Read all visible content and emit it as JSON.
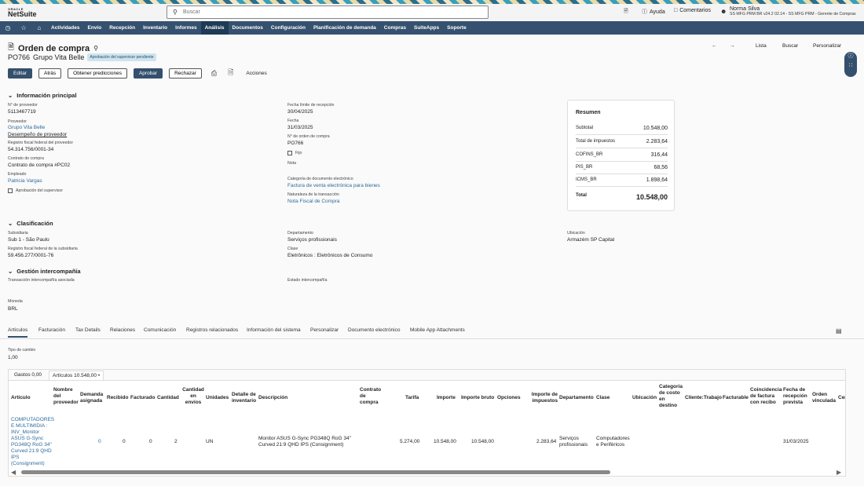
{
  "header": {
    "logo_oracle": "ORACLE",
    "logo_netsuite": "NetSuite",
    "search_placeholder": "Buscar",
    "help": "Ayuda",
    "comments": "Comentarios",
    "user_name": "Norma Silva",
    "user_role": "SS MFG PRM BR v24.2 02.14 - SS MFG PRM -  Gerente de Compras"
  },
  "nav": {
    "items": [
      "Actividades",
      "Envío",
      "Recepción",
      "Inventario",
      "Informes",
      "Análisis",
      "Documentos",
      "Configuración",
      "Planificación de demanda",
      "Compras",
      "SuiteApps",
      "Soporte"
    ],
    "active": "Análisis"
  },
  "page": {
    "title": "Orden de compra",
    "record_id": "PO766",
    "vendor_name": "Grupo Vita Belle",
    "status_badge": "Aprobación del supervisor pendiente",
    "right_links": {
      "list": "Lista",
      "search": "Buscar",
      "customize": "Personalizar"
    },
    "buttons": {
      "edit": "Editar",
      "back": "Atrás",
      "predictions": "Obtener predicciones",
      "approve": "Aprobar",
      "reject": "Rechazar",
      "actions": "Acciones"
    }
  },
  "main_info": {
    "section_title": "Información principal",
    "vendor_no_label": "N° de proveedor",
    "vendor_no": "5113467719",
    "vendor_label": "Proveedor",
    "vendor": "Grupo Vita Belle",
    "vendor_performance": "Desempeño de proveedor",
    "tax_id_label": "Registro fiscal federal del proveedor",
    "tax_id": "54.314.756/0001-34",
    "contract_label": "Contrato de compra",
    "contract": "Contrato de compra #PC02",
    "employee_label": "Empleado",
    "employee": "Patricia Vargas",
    "supervisor_approval": "Aprobación del supervisor",
    "receipt_deadline_label": "Fecha límite de recepción",
    "receipt_deadline": "30/04/2025",
    "date_label": "Fecha",
    "date": "31/03/2025",
    "po_no_label": "N° de orden de compra",
    "po_no": "PO766",
    "fixed_label": "Fijo",
    "note_label": "Nota",
    "edoc_category_label": "Categoría de documento electrónico",
    "edoc_category": "Factura de venta electrónica para bienes",
    "transaction_nature_label": "Naturaleza de la transacción",
    "transaction_nature": "Nota Fiscal de Compra"
  },
  "summary": {
    "title": "Resumen",
    "rows": [
      {
        "label": "Subtotal",
        "value": "10.548,00"
      },
      {
        "label": "Total de impuestos",
        "value": "2.283,64"
      },
      {
        "label": "COFINS_BR",
        "value": "316,44"
      },
      {
        "label": "PIS_BR",
        "value": "68,56"
      },
      {
        "label": "ICMS_BR",
        "value": "1.898,64"
      }
    ],
    "total_label": "Total",
    "total_value": "10.548,00"
  },
  "classification": {
    "section_title": "Clasificación",
    "subsidiary_label": "Subsidiaria",
    "subsidiary": "Sub 1 - São Paulo",
    "sub_tax_label": "Registro fiscal federal de la subsidiaria",
    "sub_tax": "59.456.277/0001-76",
    "department_label": "Departamento",
    "department": "Serviços profissionais",
    "class_label": "Clase",
    "class": "Eletrônicos : Eletrônicos de Consumo",
    "location_label": "Ubicación",
    "location": "Armazém SP Capital"
  },
  "intercompany": {
    "section_title": "Gestión intercompañía",
    "assoc_label": "Transacción intercompañía asociada",
    "status_label": "Estado intercompañía",
    "currency_label": "Moneda",
    "currency": "BRL"
  },
  "tabs": [
    "Artículos",
    "Facturación",
    "Tax Details",
    "Relaciones",
    "Comunicación",
    "Registros relacionados",
    "Información del sistema",
    "Personalizar",
    "Documento electrónico",
    "Mobile App Attachments"
  ],
  "items_tab": {
    "exchange_label": "Tipo de cambio",
    "exchange": "1,00",
    "subtabs": [
      "Gastos 0,00",
      "Artículos 10.548,00 •"
    ],
    "headers": [
      "Artículo",
      "Nombre del proveedor",
      "Demanda asignada",
      "Recibido",
      "Facturado",
      "Cantidad",
      "Cantidad en envíos",
      "Unidades",
      "Detalle de inventario",
      "Descripción",
      "Contrato de compra",
      "Tarifa",
      "Importe",
      "Importe bruto",
      "Opciones",
      "Importe de impuestos",
      "Departamento",
      "Clase",
      "Ubicación",
      "Categoría de costo en destino",
      "Cliente:Trabajo",
      "Facturable",
      "Coincidencia de factura con recibo",
      "Fecha de recepción prevista",
      "Orden vinculada",
      "Cer"
    ],
    "row": {
      "item": "COMPUTADORES E MULTIMIDIA : INV_Monitor ASUS G-Sync PG348Q RoG 34\" Curved 21:9 QHD IPS (Consignment)",
      "demand": "0",
      "received": "0",
      "billed": "0",
      "qty": "2",
      "units": "UN",
      "description": "Monitor ASUS G-Sync PG348Q RoG 34\" Curved 21:9 QHD IPS (Consignment)",
      "rate": "5.274,00",
      "amount": "10.548,00",
      "gross": "10.548,00",
      "tax": "2.283,64",
      "department": "Serviços profissionais",
      "class": "Computadores e Periféricos",
      "expected_date": "31/03/2025"
    }
  }
}
